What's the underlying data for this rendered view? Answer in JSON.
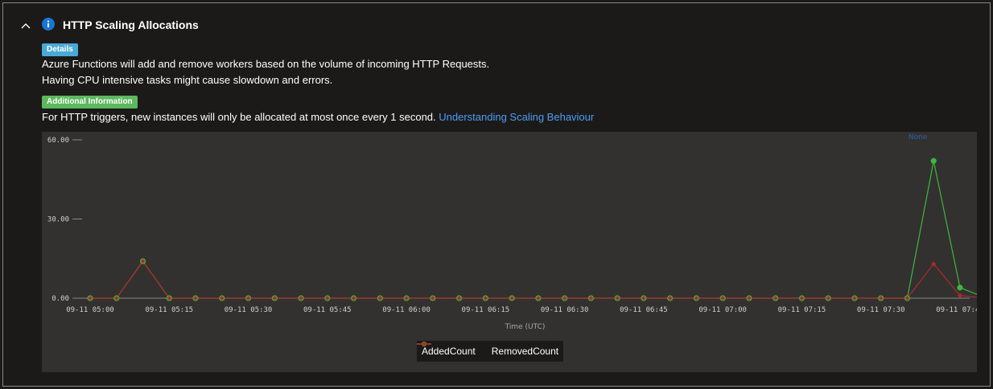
{
  "section": {
    "title": "HTTP Scaling Allocations",
    "icons": {
      "collapse": "chevron-up-icon",
      "info": "info-icon"
    }
  },
  "details": {
    "badge": "Details",
    "line1": "Azure Functions will add and remove workers based on the volume of incoming HTTP Requests.",
    "line2": "Having CPU intensive tasks might cause slowdown and errors."
  },
  "additional": {
    "badge": "Additional Information",
    "text": "For HTTP triggers, new instances will only be allocated at most once every 1 second. ",
    "link": "Understanding Scaling Behaviour"
  },
  "colors": {
    "added": "#3cb83c",
    "removed": "#b02a2a",
    "details_badge": "#4aa9d6",
    "additional_badge": "#5cb85c",
    "link": "#4f9cf5"
  },
  "chart_data": {
    "type": "line",
    "xlabel": "Time (UTC)",
    "ylabel": "",
    "ylim": [
      0,
      60
    ],
    "yticks": [
      "60.00",
      "30.00",
      "0.00"
    ],
    "ytick_values": [
      60,
      30,
      0
    ],
    "xticks": [
      "09-11 05:00",
      "09-11 05:15",
      "09-11 05:30",
      "09-11 05:45",
      "09-11 06:00",
      "09-11 06:15",
      "09-11 06:30",
      "09-11 06:45",
      "09-11 07:00",
      "09-11 07:15",
      "09-11 07:30",
      "09-11 07:45"
    ],
    "annotation": "None",
    "legend_position": "bottom",
    "x_minutes": [
      0,
      5,
      10,
      15,
      20,
      25,
      30,
      35,
      40,
      45,
      50,
      55,
      60,
      65,
      70,
      75,
      80,
      85,
      90,
      95,
      100,
      105,
      110,
      115,
      120,
      125,
      130,
      135,
      140,
      145,
      150,
      155,
      160,
      165,
      170,
      175
    ],
    "series": [
      {
        "name": "AddedCount",
        "values": [
          0,
          0,
          14,
          0,
          0,
          0,
          0,
          0,
          0,
          0,
          0,
          0,
          0,
          0,
          0,
          0,
          0,
          0,
          0,
          0,
          0,
          0,
          0,
          0,
          0,
          0,
          0,
          0,
          0,
          0,
          0,
          0,
          52,
          4,
          0
        ]
      },
      {
        "name": "RemovedCount",
        "values": [
          0,
          0,
          14,
          0,
          0,
          0,
          0,
          0,
          0,
          0,
          0,
          0,
          0,
          0,
          0,
          0,
          0,
          0,
          0,
          0,
          0,
          0,
          0,
          0,
          0,
          0,
          0,
          0,
          0,
          0,
          0,
          0,
          13,
          1,
          0
        ]
      }
    ]
  }
}
